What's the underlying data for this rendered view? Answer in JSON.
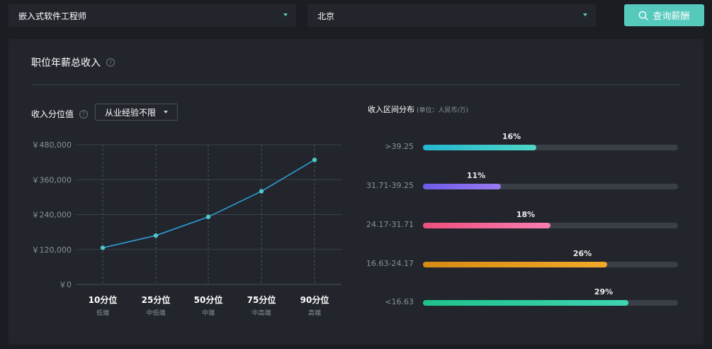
{
  "filters": {
    "job": "嵌入式软件工程师",
    "city": "北京",
    "search_label": "查询薪酬"
  },
  "card": {
    "title": "职位年薪总收入",
    "percentile_title": "收入分位值",
    "experience_select": "从业经验不限",
    "distribution_title": "收入区间分布",
    "distribution_unit": "(单位：人民币/万)"
  },
  "chart_data": {
    "type": "line",
    "categories": [
      "10分位",
      "25分位",
      "50分位",
      "75分位",
      "90分位"
    ],
    "category_sublabels": [
      "低端",
      "中低端",
      "中端",
      "中高端",
      "高端"
    ],
    "values": [
      126000,
      168000,
      232000,
      320000,
      428000
    ],
    "y_ticks": [
      "￥0",
      "￥120,000",
      "￥240,000",
      "￥360,000",
      "￥480,000"
    ],
    "ylim": [
      0,
      480000
    ],
    "grid": true,
    "line_color": "#2f9bd6",
    "point_color": "#4fc7c4"
  },
  "distribution": [
    {
      "label": ">39.25",
      "pct": 16,
      "pct_label": "16%",
      "color_from": "#25b7cf",
      "color_to": "#4fd6c8"
    },
    {
      "label": "31.71-39.25",
      "pct": 11,
      "pct_label": "11%",
      "color_from": "#6b5ce8",
      "color_to": "#9a7bf0"
    },
    {
      "label": "24.17-31.71",
      "pct": 18,
      "pct_label": "18%",
      "color_from": "#ee4f7e",
      "color_to": "#f77fb0"
    },
    {
      "label": "16.63-24.17",
      "pct": 26,
      "pct_label": "26%",
      "color_from": "#d78a12",
      "color_to": "#f3a929"
    },
    {
      "label": "<16.63",
      "pct": 29,
      "pct_label": "29%",
      "color_from": "#1ec28a",
      "color_to": "#3fd4b4"
    }
  ]
}
